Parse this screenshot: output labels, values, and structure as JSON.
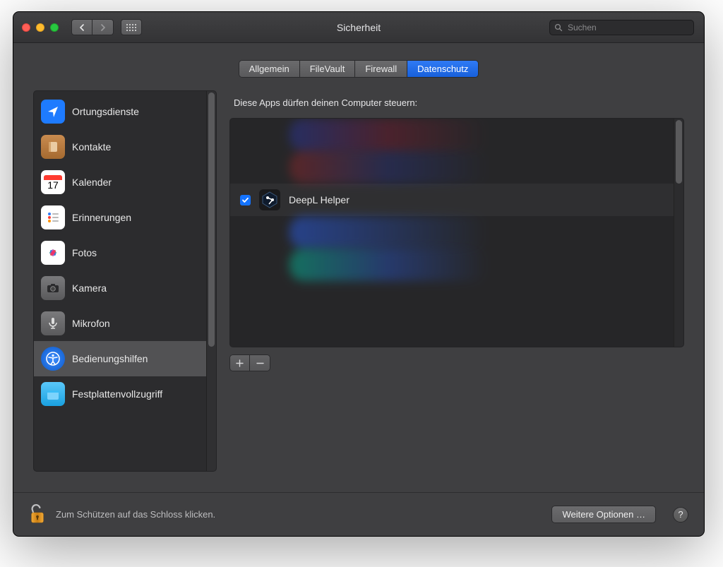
{
  "window": {
    "title": "Sicherheit"
  },
  "search": {
    "placeholder": "Suchen"
  },
  "tabs": [
    {
      "label": "Allgemein",
      "active": false
    },
    {
      "label": "FileVault",
      "active": false
    },
    {
      "label": "Firewall",
      "active": false
    },
    {
      "label": "Datenschutz",
      "active": true
    }
  ],
  "sidebar": {
    "items": [
      {
        "label": "Ortungsdienste",
        "icon": "location-icon",
        "bg": "#1e7bff"
      },
      {
        "label": "Kontakte",
        "icon": "contacts-icon",
        "bg": "#b3783e"
      },
      {
        "label": "Kalender",
        "icon": "calendar-icon",
        "bg": "#ffffff"
      },
      {
        "label": "Erinnerungen",
        "icon": "reminders-icon",
        "bg": "#ffffff"
      },
      {
        "label": "Fotos",
        "icon": "photos-icon",
        "bg": "#ffffff"
      },
      {
        "label": "Kamera",
        "icon": "camera-icon",
        "bg": "#6a6a6c"
      },
      {
        "label": "Mikrofon",
        "icon": "microphone-icon",
        "bg": "#6a6a6c"
      },
      {
        "label": "Bedienungshilfen",
        "icon": "accessibility-icon",
        "bg": "#1e7bff",
        "selected": true
      },
      {
        "label": "Festplattenvollzugriff",
        "icon": "folder-icon",
        "bg": "#34b7ff"
      }
    ],
    "calendar_day": "17"
  },
  "main": {
    "heading": "Diese Apps dürfen deinen Computer steuern:",
    "apps": [
      {
        "name": "DeepL Helper",
        "checked": true
      }
    ],
    "add_label": "+",
    "remove_label": "−"
  },
  "footer": {
    "lock_text": "Zum Schützen auf das Schloss klicken.",
    "more_options": "Weitere Optionen …",
    "help": "?"
  }
}
